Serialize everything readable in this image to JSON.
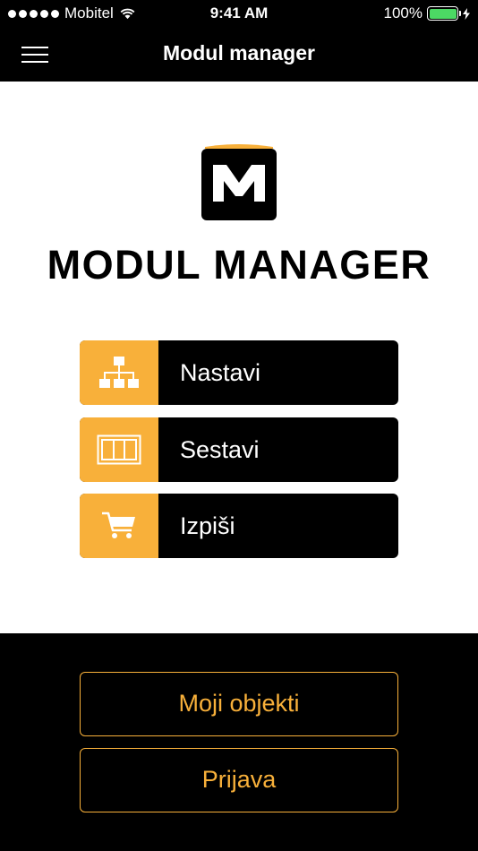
{
  "status_bar": {
    "carrier": "Mobitel",
    "time": "9:41 AM",
    "battery": "100%",
    "battery_level": 1.0,
    "icons": [
      "signal-dots-icon",
      "wifi-icon",
      "battery-icon",
      "charging-bolt-icon"
    ]
  },
  "nav": {
    "title": "Modul manager",
    "menu_icon": "hamburger-menu-icon"
  },
  "brand": {
    "logo_letter": "M",
    "title": "MODUL MANAGER"
  },
  "menu_items": [
    {
      "label": "Nastavi",
      "icon": "org-chart-icon"
    },
    {
      "label": "Sestavi",
      "icon": "cabinet-module-icon"
    },
    {
      "label": "Izpiši",
      "icon": "shopping-cart-icon"
    }
  ],
  "bottom_buttons": [
    {
      "label": "Moji objekti"
    },
    {
      "label": "Prijava"
    }
  ],
  "colors": {
    "accent": "#f8b03a",
    "background_dark": "#000000",
    "background_light": "#ffffff",
    "battery_green": "#4cd964"
  }
}
